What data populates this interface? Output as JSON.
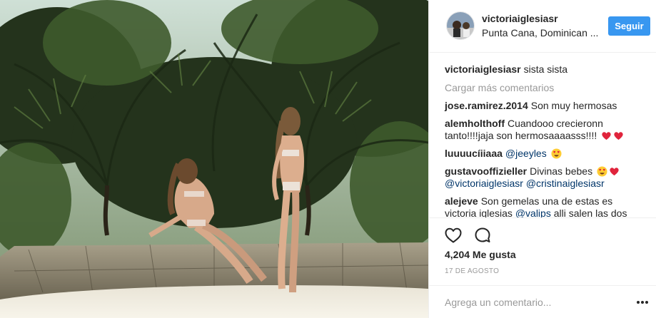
{
  "header": {
    "username": "victoriaiglesiasr",
    "location": "Punta Cana, Dominican ...",
    "follow_label": "Seguir"
  },
  "comments": {
    "caption": {
      "user": "victoriaiglesiasr",
      "text": "sista sista"
    },
    "load_more": "Cargar más comentarios",
    "items": [
      {
        "user": "jose.ramirez.2014",
        "text": "Son muy hermosas"
      },
      {
        "user": "alemholthoff",
        "text": "Cuandooo crecieronn tanto!!!!jaja son hermosaaaasss!!!!",
        "emojis": [
          "red-heart",
          "red-heart"
        ]
      },
      {
        "user": "luuuucíiiaaa",
        "mention": "@jeeyles",
        "emojis": [
          "heart-eyes"
        ]
      },
      {
        "user": "gustavooffizieller",
        "text": "Divinas bebes",
        "emojis": [
          "heart-eyes",
          "red-heart"
        ],
        "mention1": "@victoriaiglesiasr",
        "mention2": "@cristinaiglesiasr"
      },
      {
        "user": "alejeve",
        "text": "Son gemelas una de estas es victoria iglesias",
        "mention": "@valips",
        "text2": "alli salen las dos"
      }
    ]
  },
  "actions": {
    "like_icon": "heart-outline-icon",
    "comment_icon": "speech-bubble-icon",
    "likes": "4,204 Me gusta",
    "date": "17 DE AGOSTO"
  },
  "add_comment": {
    "placeholder": "Agrega un comentario...",
    "more_icon": "ellipsis-icon"
  },
  "colors": {
    "follow_bg": "#3897f0",
    "mention": "#003569",
    "muted": "#999999",
    "text": "#262626",
    "heart": "#e0243c"
  }
}
